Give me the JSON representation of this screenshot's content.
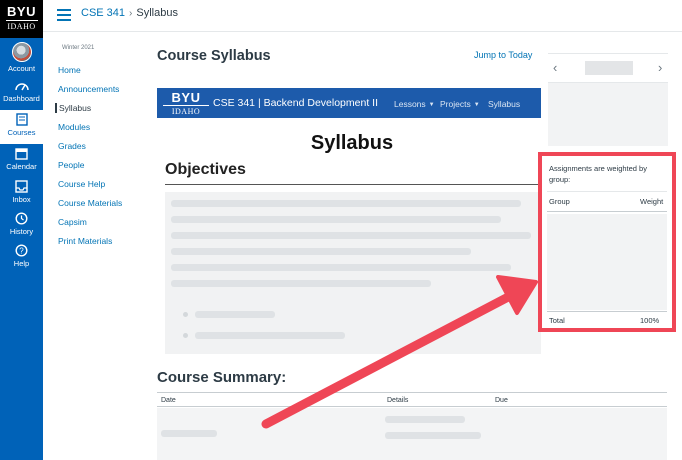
{
  "global_nav": {
    "logo_line1": "BYU",
    "logo_line2": "IDAHO",
    "items": [
      {
        "label": "Account",
        "icon": "account-avatar"
      },
      {
        "label": "Dashboard",
        "icon": "dashboard-icon"
      },
      {
        "label": "Courses",
        "icon": "book-icon"
      },
      {
        "label": "Calendar",
        "icon": "calendar-icon"
      },
      {
        "label": "Inbox",
        "icon": "inbox-icon"
      },
      {
        "label": "History",
        "icon": "clock-icon"
      },
      {
        "label": "Help",
        "icon": "help-icon"
      }
    ],
    "active": "Courses",
    "color": "#0062b8"
  },
  "header": {
    "course_link": "CSE 341",
    "separator": "›",
    "current": "Syllabus"
  },
  "course_nav": {
    "term": "Winter 2021",
    "items": [
      "Home",
      "Announcements",
      "Syllabus",
      "Modules",
      "Grades",
      "People",
      "Course Help",
      "Course Materials",
      "Capsim",
      "Print Materials"
    ],
    "active": "Syllabus"
  },
  "main": {
    "title": "Course Syllabus",
    "jump_link": "Jump to Today",
    "banner": {
      "logo_line1": "BYU",
      "logo_line2": "IDAHO",
      "title": "CSE 341 | Backend Development II",
      "menu": [
        "Lessons",
        "Projects",
        "Syllabus"
      ],
      "color": "#1d5bab"
    },
    "syllabus_heading": "Syllabus",
    "objectives_heading": "Objectives",
    "summary_heading": "Course Summary:",
    "summary_columns": [
      "Date",
      "Details",
      "Due"
    ]
  },
  "sidebar": {
    "calendar_prev": "‹",
    "calendar_next": "›",
    "weights": {
      "title": "Assignments are weighted by group:",
      "col_group": "Group",
      "col_weight": "Weight",
      "total_label": "Total",
      "total_value": "100%"
    }
  },
  "annotation": {
    "highlight_color": "#ef4656"
  }
}
